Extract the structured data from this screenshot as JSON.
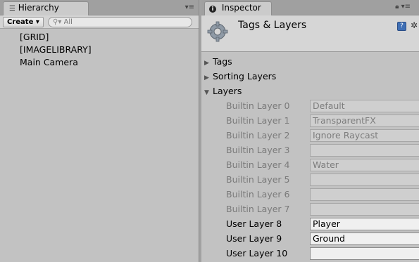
{
  "hierarchy": {
    "tab_label": "Hierarchy",
    "create_label": "Create ▾",
    "search_placeholder": "All",
    "items": [
      "[GRID]",
      "[IMAGELIBRARY]",
      "Main Camera"
    ]
  },
  "inspector": {
    "tab_label": "Inspector",
    "title": "Tags & Layers",
    "sections": {
      "tags": "Tags",
      "sorting_layers": "Sorting Layers",
      "layers": "Layers"
    },
    "layers": [
      {
        "label": "Builtin Layer 0",
        "value": "Default"
      },
      {
        "label": "Builtin Layer 1",
        "value": "TransparentFX"
      },
      {
        "label": "Builtin Layer 2",
        "value": "Ignore Raycast"
      },
      {
        "label": "Builtin Layer 3",
        "value": ""
      },
      {
        "label": "Builtin Layer 4",
        "value": "Water"
      },
      {
        "label": "Builtin Layer 5",
        "value": ""
      },
      {
        "label": "Builtin Layer 6",
        "value": ""
      },
      {
        "label": "Builtin Layer 7",
        "value": ""
      },
      {
        "label": "User Layer 8",
        "value": "Player"
      },
      {
        "label": "User Layer 9",
        "value": "Ground"
      },
      {
        "label": "User Layer 10",
        "value": ""
      }
    ]
  },
  "colors": {
    "panel_bg": "#c2c2c2",
    "disabled_text": "#7a7a7a",
    "help_blue": "#3f6fb5"
  }
}
